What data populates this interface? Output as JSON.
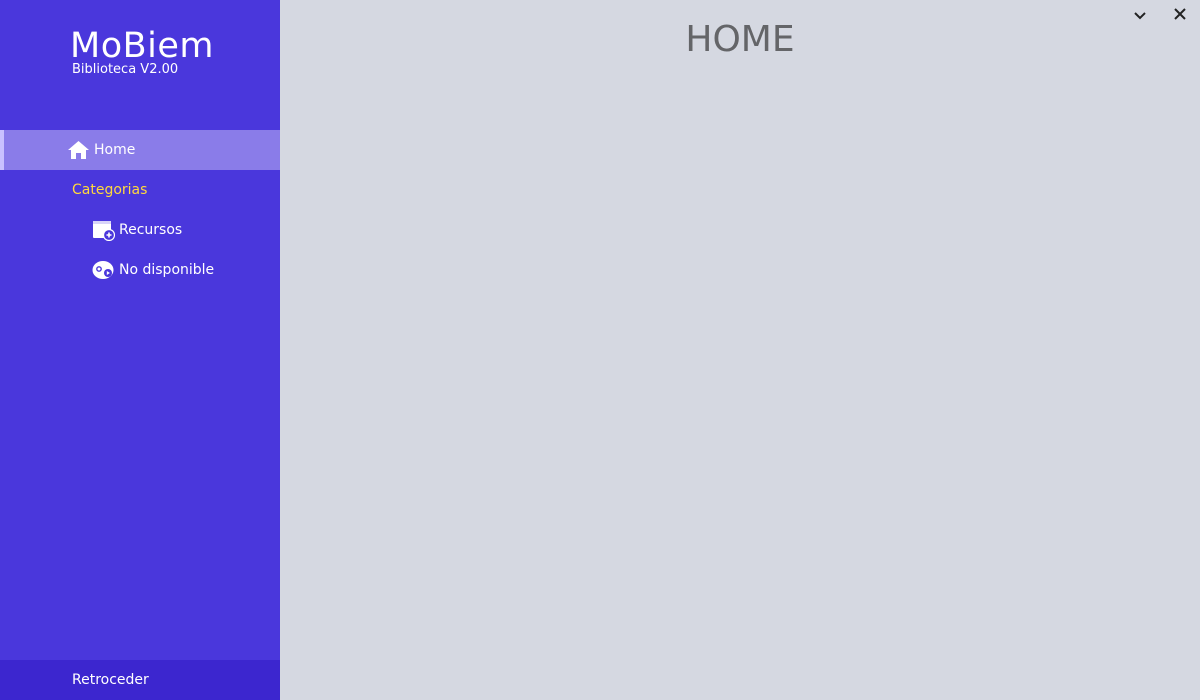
{
  "brand": {
    "title": "MoBiem",
    "subtitle": "Biblioteca V2.00"
  },
  "sidebar": {
    "items": [
      {
        "label": "Home",
        "icon": "home-icon",
        "active": true
      },
      {
        "label": "Categorias",
        "icon": "",
        "active": false
      },
      {
        "label": "Recursos",
        "icon": "folder-add-icon",
        "active": false
      },
      {
        "label": "No disponible",
        "icon": "unavailable-icon",
        "active": false
      }
    ],
    "footer": {
      "label": "Retroceder"
    }
  },
  "main": {
    "title": "HOME"
  },
  "window_controls": {
    "minimize_icon": "chevron-down-icon",
    "close_icon": "close-icon"
  },
  "colors": {
    "sidebar_bg": "#4a37dc",
    "active_item_bg": "#8a7ce9",
    "category_label": "#ffd93d",
    "main_bg": "#d5d8e1",
    "title_text": "#646568"
  }
}
